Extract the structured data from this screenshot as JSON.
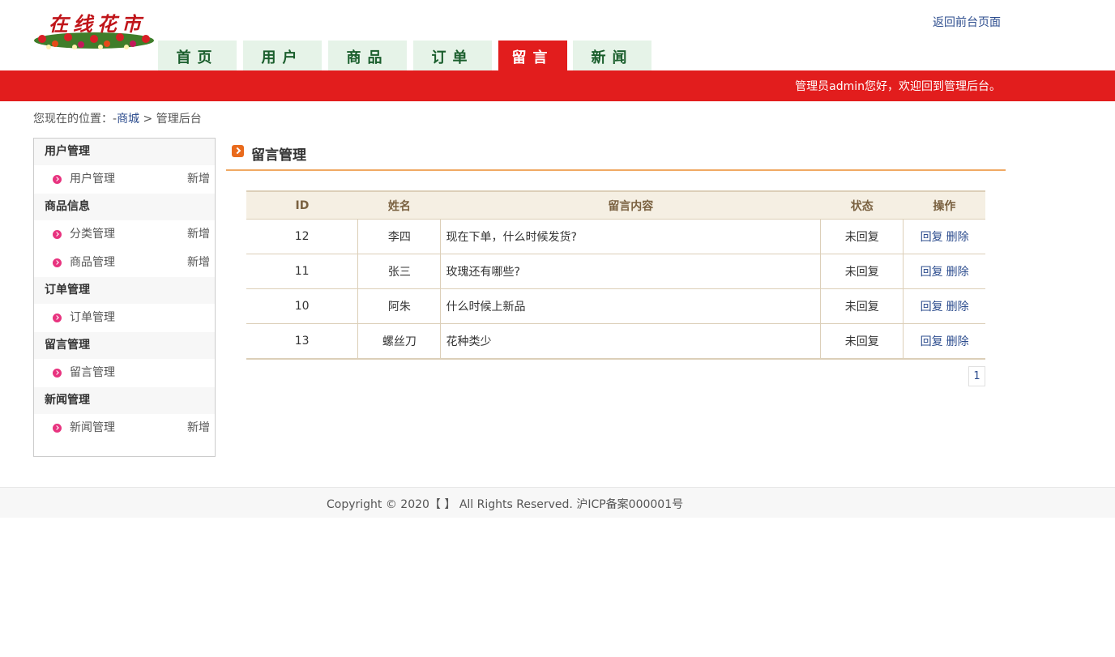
{
  "header": {
    "logo_text": "在线花市",
    "back_link": "返回前台页面",
    "nav": [
      {
        "label": "首页",
        "active": false
      },
      {
        "label": "用户",
        "active": false
      },
      {
        "label": "商品",
        "active": false
      },
      {
        "label": "订单",
        "active": false
      },
      {
        "label": "留言",
        "active": true
      },
      {
        "label": "新闻",
        "active": false
      }
    ],
    "welcome": "管理员admin您好，欢迎回到管理后台。"
  },
  "breadcrumb": {
    "prefix": "您现在的位置：-",
    "link": "商城",
    "sep": " > ",
    "current": "管理后台"
  },
  "sidebar": {
    "groups": [
      {
        "title": "用户管理",
        "items": [
          {
            "label": "用户管理",
            "add": "新增"
          }
        ]
      },
      {
        "title": "商品信息",
        "items": [
          {
            "label": "分类管理",
            "add": "新增"
          },
          {
            "label": "商品管理",
            "add": "新增"
          }
        ]
      },
      {
        "title": "订单管理",
        "items": [
          {
            "label": "订单管理",
            "add": ""
          }
        ]
      },
      {
        "title": "留言管理",
        "items": [
          {
            "label": "留言管理",
            "add": ""
          }
        ]
      },
      {
        "title": "新闻管理",
        "items": [
          {
            "label": "新闻管理",
            "add": "新增"
          }
        ]
      }
    ]
  },
  "main": {
    "title": "留言管理",
    "table": {
      "headers": [
        "ID",
        "姓名",
        "留言内容",
        "状态",
        "操作"
      ],
      "rows": [
        {
          "id": "12",
          "name": "李四",
          "content": "现在下单，什么时候发货?",
          "status": "未回复"
        },
        {
          "id": "11",
          "name": "张三",
          "content": "玫瑰还有哪些?",
          "status": "未回复"
        },
        {
          "id": "10",
          "name": "阿朱",
          "content": "什么时候上新品",
          "status": "未回复"
        },
        {
          "id": "13",
          "name": "螺丝刀",
          "content": "花种类少",
          "status": "未回复"
        }
      ],
      "reply_label": "回复",
      "delete_label": "删除"
    },
    "pager": "1"
  },
  "footer": {
    "text": "Copyright © 2020【 】 All Rights Reserved. 沪ICP备案000001号"
  },
  "colors": {
    "brand_red": "#e21d1d",
    "nav_tab_bg": "#e6f3e8",
    "link_blue": "#2d4d8e",
    "accent_orange": "#f0a964"
  }
}
